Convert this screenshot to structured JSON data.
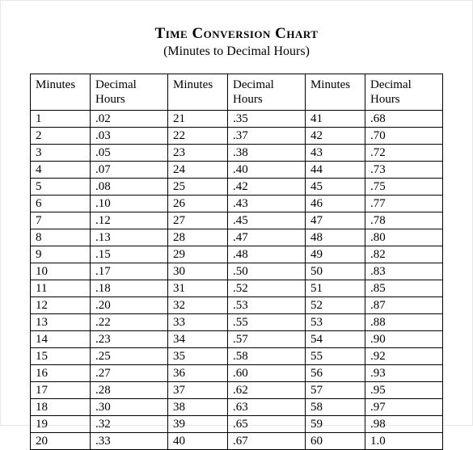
{
  "title": "Time Conversion Chart",
  "subtitle": "(Minutes to Decimal Hours)",
  "headers": {
    "minutes": "Minutes",
    "decimal": "Decimal Hours"
  },
  "columns": [
    [
      {
        "m": "1",
        "d": ".02"
      },
      {
        "m": "2",
        "d": ".03"
      },
      {
        "m": "3",
        "d": ".05"
      },
      {
        "m": "4",
        "d": ".07"
      },
      {
        "m": "5",
        "d": ".08"
      },
      {
        "m": "6",
        "d": ".10"
      },
      {
        "m": "7",
        "d": ".12"
      },
      {
        "m": "8",
        "d": ".13"
      },
      {
        "m": "9",
        "d": ".15"
      },
      {
        "m": "10",
        "d": ".17"
      },
      {
        "m": "11",
        "d": ".18"
      },
      {
        "m": "12",
        "d": ".20"
      },
      {
        "m": "13",
        "d": ".22"
      },
      {
        "m": "14",
        "d": ".23"
      },
      {
        "m": "15",
        "d": ".25"
      },
      {
        "m": "16",
        "d": ".27"
      },
      {
        "m": "17",
        "d": ".28"
      },
      {
        "m": "18",
        "d": ".30"
      },
      {
        "m": "19",
        "d": ".32"
      },
      {
        "m": "20",
        "d": ".33"
      }
    ],
    [
      {
        "m": "21",
        "d": ".35"
      },
      {
        "m": "22",
        "d": ".37"
      },
      {
        "m": "23",
        "d": ".38"
      },
      {
        "m": "24",
        "d": ".40"
      },
      {
        "m": "25",
        "d": ".42"
      },
      {
        "m": "26",
        "d": ".43"
      },
      {
        "m": "27",
        "d": ".45"
      },
      {
        "m": "28",
        "d": ".47"
      },
      {
        "m": "29",
        "d": ".48"
      },
      {
        "m": "30",
        "d": ".50"
      },
      {
        "m": "31",
        "d": ".52"
      },
      {
        "m": "32",
        "d": ".53"
      },
      {
        "m": "33",
        "d": ".55"
      },
      {
        "m": "34",
        "d": ".57"
      },
      {
        "m": "35",
        "d": ".58"
      },
      {
        "m": "36",
        "d": ".60"
      },
      {
        "m": "37",
        "d": ".62"
      },
      {
        "m": "38",
        "d": ".63"
      },
      {
        "m": "39",
        "d": ".65"
      },
      {
        "m": "40",
        "d": ".67"
      }
    ],
    [
      {
        "m": "41",
        "d": ".68"
      },
      {
        "m": "42",
        "d": ".70"
      },
      {
        "m": "43",
        "d": ".72"
      },
      {
        "m": "44",
        "d": ".73"
      },
      {
        "m": "45",
        "d": ".75"
      },
      {
        "m": "46",
        "d": ".77"
      },
      {
        "m": "47",
        "d": ".78"
      },
      {
        "m": "48",
        "d": ".80"
      },
      {
        "m": "49",
        "d": ".82"
      },
      {
        "m": "50",
        "d": ".83"
      },
      {
        "m": "51",
        "d": ".85"
      },
      {
        "m": "52",
        "d": ".87"
      },
      {
        "m": "53",
        "d": ".88"
      },
      {
        "m": "54",
        "d": ".90"
      },
      {
        "m": "55",
        "d": ".92"
      },
      {
        "m": "56",
        "d": ".93"
      },
      {
        "m": "57",
        "d": ".95"
      },
      {
        "m": "58",
        "d": ".97"
      },
      {
        "m": "59",
        "d": ".98"
      },
      {
        "m": "60",
        "d": "1.0"
      }
    ]
  ]
}
